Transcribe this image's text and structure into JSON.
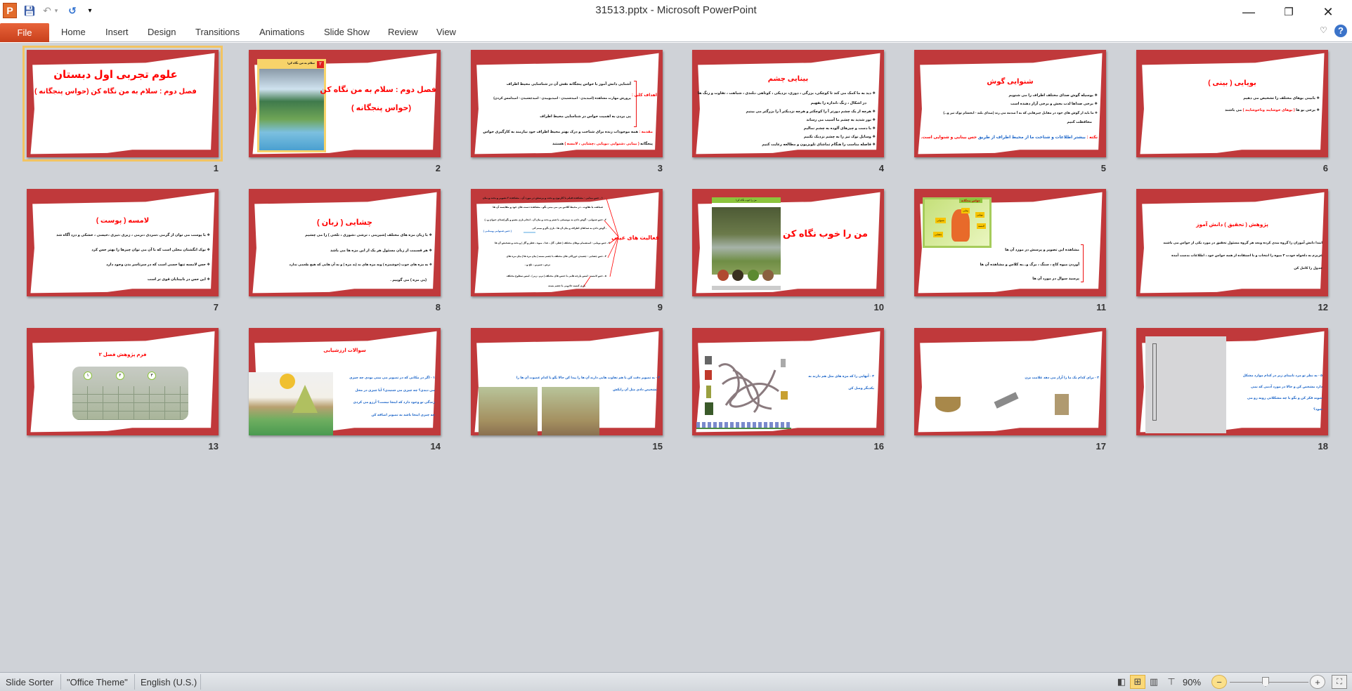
{
  "window": {
    "title": "31513.pptx  -  Microsoft PowerPoint"
  },
  "qat": {
    "app_icon": "powerpoint-icon",
    "save_icon": "save-icon",
    "undo_icon": "undo-icon",
    "redo_icon": "redo-icon",
    "customize_icon": "customize-qat-icon"
  },
  "ribbon": {
    "file": "File",
    "tabs": [
      "Home",
      "Insert",
      "Design",
      "Transitions",
      "Animations",
      "Slide Show",
      "Review",
      "View"
    ]
  },
  "slides": [
    {
      "num": "1",
      "title": "علوم تجربی اول دبستان",
      "subtitle": "فصل دوم : سلام به من نگاه کن (حواس پنجگانه )"
    },
    {
      "num": "2",
      "line1": "فصل دوم : سلام به من نگاه کن",
      "line2": "(حواس پنجگانه )",
      "book_num": "۲",
      "book_title": "سلام به من نگاه کن!"
    },
    {
      "num": "3",
      "label": "اهداف کلی :",
      "lines": [
        "آشنایی دانش آموز با حواس پنجگانه نقش آن در شناسایی محیط اطراف",
        "پرورش مهارت مشاهده (امیدیدن - امیدشنیدن - امیدبوییدن - امیدچشیدن - امیدلمس کردن)",
        "پی بردن به اهمیت حواس در شناسایی محیط اطراف"
      ],
      "intro_label": "مقدمه :",
      "intro": "همه موجودات زنده برای شناخت و درک بهتر محیط اطراف خود نیازمند به کارگیری حواس",
      "intro2_a": "پنجگانه",
      "intro2_b": "( بینایی ،شنوایی ،بویایی ،چشایی ، لامسه )",
      "intro2_c": "هستند"
    },
    {
      "num": "4",
      "title": "بینایی چشم",
      "lines": [
        "❖ دید به ما کمک می کند تا کوچکی، بزرگی ، دوری، نزدیکی ، کوتاهی ،بلندی ، شباهت ، تفاوت و رنگ ها",
        "در اشکال ، رنگ ،اندازه را بفهیم",
        "❖ هرچه از یک چشم دورتر آ را کوچکتر و هرچه نزدیکتر آ را بزرگتر می بینیم",
        "❖ نور شدید به چشم ما آسیب می رساند",
        "❖ با دست و چیزهای آلوده به چشم نمالیم",
        "❖ وسایل نوک تیز را به چشم نزدیک نکنیم",
        "❖ فاصله مناسب را هنگام تماشای تلویزیون و مطالعه رعایت کنیم"
      ]
    },
    {
      "num": "5",
      "title": "شنوایی گوش",
      "lines": [
        "❖ بوسیله گوش صدای مختلف اطراف را می شنویم",
        "❖ برخی صداها لذت بخش و برخی آزار دهنده است",
        "❖ ما باید از گوش های خود در مقابل چیزهایی که به آ صدمه می زند (صدای بلند - ایجسام نوک تیز و...)",
        "محافظت کنیم"
      ],
      "note_label": "نکته :",
      "note_a": "بیشتر اطلاعات و شناخت ما از محیط اطراف از طریق",
      "note_b": "حس بینایی و شنوایی است."
    },
    {
      "num": "6",
      "title": "بویایی ( بینی )",
      "line1": "❖ بابینی بوهای مختلف را تشخیص می دهیم",
      "line2_a": "❖ برخی بو ها",
      "line2_b": "( بوهای خوشایند وناخوشایند )",
      "line2_c": "می باشند"
    },
    {
      "num": "7",
      "title": "لامسه ( پوست )",
      "lines": [
        "❖ با پوست می توان از گرمی ،سردی ،نرمی ، زبری ،تیزی ،خیسی ، خشکی و درد آگاه شد",
        "❖ نوک انگشتان محلی است که با آن می توان چیزها را بهتر حس کرد",
        "❖ حس لامسه تنها حسی است که در سرتاسر بدن وجود دارد",
        "❖ این حس در نابینایان قوی تر است"
      ]
    },
    {
      "num": "8",
      "title": "چشایی ( زبان )",
      "lines": [
        "❖ با زبان مزه های مختلف (شیرینی ، ترشی ،شوری ، تلخی ) را می چشیم",
        "❖ هر قسمت از زبان مسئول هر یک از این مزه ها می باشد",
        "❖ به مزه های خوب (خوشمزه ) وبه مزه های بد (بد مزه ) و به آن هایی که هیچ طعمی ندارد",
        "(بی مزه ) می گوییم ."
      ]
    },
    {
      "num": "9",
      "title": "فعالیت های عینی",
      "lines": [
        "۱ - حس بینایی : مشاهده فیلم یا کارتون و بحث و پرسش در مورد آن - مشاهده ۲ تصویر و بحث و بیان",
        "شباهت یا تفاوت - در محیط کلاس پی می بینی بگو - مشاهده دست های خود و مقایسه آن ها",
        "۲ - حس شنوایی : گوش دادن به موسیقی یا شعر و بحث و بیان آن - انجام بازی بشنو و بگو (صدای حیوان و...)",
        "- گوش دادن به صداهای اطراف و بیان آن ها - بازی بگو و ببینم کی",
        "۳ - حس بویایی : استشمام بوهای مختلف ( عطر ، گل ، غذا ، میوه ، عطر و گل ) و بحث و تشخیص آن ها",
        "۴ - حس چشایی : چشیدن خوراکی های مختلف با چشم بسته ( بیان مزه ها ) بیان مزه های",
        "ترش ، شیرین ، تلخ و...",
        "۵ - حس لامسه : لمس پارچه هایی با جنس های مختلف ( نرم ، زبر ) - لمس سطوح مختلف",
        "بازی کیسه جادویی با چشم بسته"
      ],
      "aside": "( حس شنوایی وبینایی )"
    },
    {
      "num": "10",
      "title": "من را خوب نگاه کن",
      "book_title": "من را خوب نگاه کن!"
    },
    {
      "num": "11",
      "lines": [
        "مشاهده این تصویر و پرسش در مورد آن ها",
        "آوردن میوه کاج ، سنگ ، برگ و...به کلاس و مشاهده آن ها",
        "پرسید سوال در مورد آن ها"
      ],
      "card_title": "حواس پنجگانه",
      "card_items": [
        "بینایی",
        "شنوایی",
        "بویایی",
        "لامسه",
        "چشایی"
      ]
    },
    {
      "num": "12",
      "title": "پژوهش ( تحقیق ) دانش آموز",
      "lines": [
        "ابتدا دانش آموزان را گروه بندی کرده وبعد هر گروه مسئول تحقیق در مورد یکی از حواس می باشند",
        "عزیزم به دلخواه خودت ۳ میوه را انتخاب و با استفاده از همه حواس خود ، اطلاعات بدست آمده",
        "جدول را کامل کن"
      ]
    },
    {
      "num": "13",
      "title": "فرم پژوهش فصل ۲",
      "cols": [
        "۱",
        "۲",
        "۳"
      ]
    },
    {
      "num": "14",
      "title": "سوالات ارزشیابی",
      "lines": [
        "۱ - اگر در مکانی که در تصویر می بینی بودی چه چیزی",
        "می دیدی؟ چه چیزی می شنیدی؟ آیا چیزی در محل",
        "زندگی تو وجود دارد که اینجا نیست؟ آرزو می کردی",
        "چه چیزی اینجا باشد به تصویر اضافه کن"
      ]
    },
    {
      "num": "15",
      "lines": [
        "۲ - به تصویر دقت کن با هم تفاوت هایی دارند آن ها را پیدا کن حالا بگو با کدام عضوت آن ها را",
        "تشخیص دادی مثل آن رابکش"
      ]
    },
    {
      "num": "16",
      "lines": [
        "۳ - آنهایی را که مزه های مثل هم دارند به",
        "یکدیگر وصل کن"
      ]
    },
    {
      "num": "17",
      "lines": [
        "۴ - برای کدام یک ما را آزار می دهد علامت بزن"
      ]
    },
    {
      "num": "18",
      "lines": [
        "۵ - به نظر تو مرد نابینای زیر در کدام موارد مشکل",
        "دارد مشخص کن و حالا در مورد آدمی که نمی",
        "شوند فکر کن و بگو با چه مشکلاتی روبه رو می",
        "شود؟"
      ]
    }
  ],
  "status": {
    "view": "Slide Sorter",
    "theme": "\"Office Theme\"",
    "language": "English (U.S.)",
    "zoom": "90%",
    "zoom_percent": 90
  },
  "colors": {
    "accent": "#c0393b",
    "title_red": "#ff0000",
    "text_blue": "#1a64c8",
    "file_tab": "#d9532a"
  }
}
